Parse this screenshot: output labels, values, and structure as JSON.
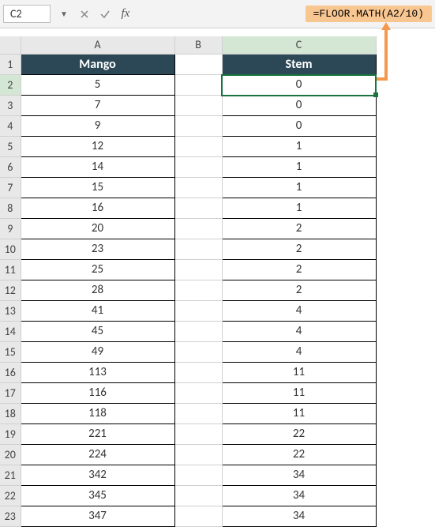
{
  "formula_bar": {
    "name_box": "C2",
    "formula": "=FLOOR.MATH(A2/10)"
  },
  "columns": [
    "A",
    "B",
    "C"
  ],
  "active_cell": "C2",
  "chart_data": {
    "type": "table",
    "columns": [
      {
        "col": "A",
        "header": "Mango",
        "values": [
          "5",
          "7",
          "9",
          "12",
          "14",
          "15",
          "16",
          "20",
          "23",
          "25",
          "28",
          "41",
          "45",
          "49",
          "113",
          "116",
          "118",
          "221",
          "224",
          "342",
          "345",
          "347"
        ]
      },
      {
        "col": "B",
        "header": "",
        "values": [
          "",
          "",
          "",
          "",
          "",
          "",
          "",
          "",
          "",
          "",
          "",
          "",
          "",
          "",
          "",
          "",
          "",
          "",
          "",
          "",
          "",
          ""
        ]
      },
      {
        "col": "C",
        "header": "Stem",
        "values": [
          "0",
          "0",
          "0",
          "1",
          "1",
          "1",
          "1",
          "2",
          "2",
          "2",
          "2",
          "4",
          "4",
          "4",
          "11",
          "11",
          "11",
          "22",
          "22",
          "34",
          "34",
          "34"
        ]
      }
    ]
  },
  "row_nums": [
    "1",
    "2",
    "3",
    "4",
    "5",
    "6",
    "7",
    "8",
    "9",
    "10",
    "11",
    "12",
    "13",
    "14",
    "15",
    "16",
    "17",
    "18",
    "19",
    "20",
    "21",
    "22",
    "23"
  ]
}
